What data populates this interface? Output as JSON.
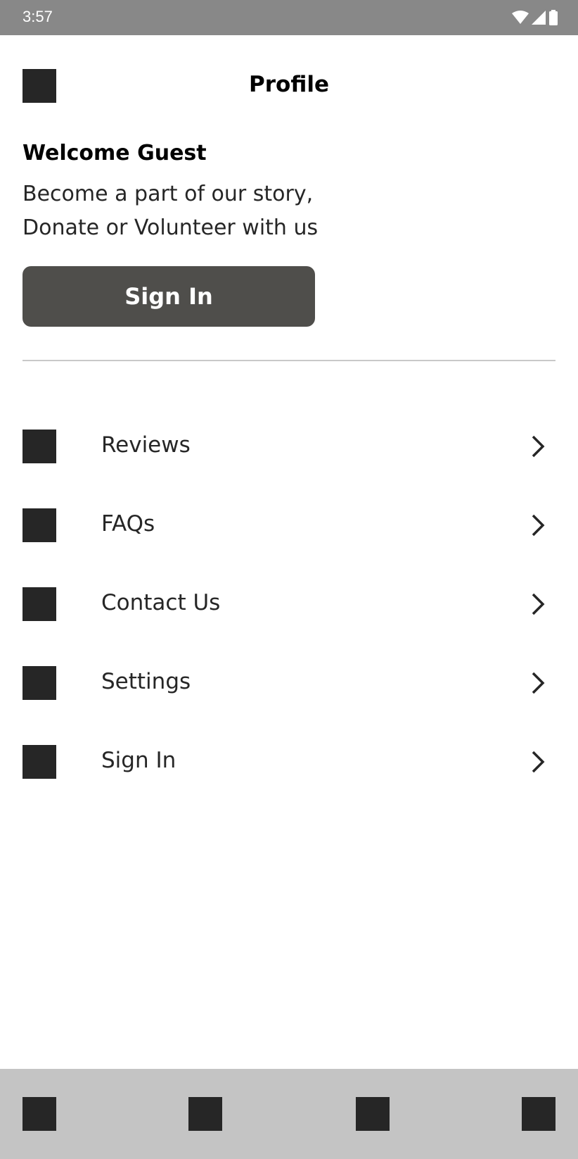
{
  "status_bar": {
    "time": "3:57",
    "icons": [
      "wifi-icon",
      "signal-icon",
      "battery-icon"
    ]
  },
  "header": {
    "title": "Profile",
    "back_icon": "square-icon"
  },
  "welcome": {
    "heading": "Welcome Guest",
    "line1": "Become a part of our story,",
    "line2": "Donate or Volunteer with us",
    "button_label": "Sign In"
  },
  "menu": {
    "items": [
      {
        "label": "Reviews",
        "icon": "square-icon"
      },
      {
        "label": "FAQs",
        "icon": "square-icon"
      },
      {
        "label": "Contact Us",
        "icon": "square-icon"
      },
      {
        "label": "Settings",
        "icon": "square-icon"
      },
      {
        "label": "Sign In",
        "icon": "square-icon"
      }
    ]
  },
  "bottom_nav": {
    "items": [
      "square-icon",
      "square-icon",
      "square-icon",
      "square-icon"
    ]
  },
  "colors": {
    "status_bar": "#888888",
    "button": "#4f4e4b",
    "icon": "#262626",
    "bottom_nav": "#c4c4c4",
    "divider": "#c9c9c9"
  }
}
